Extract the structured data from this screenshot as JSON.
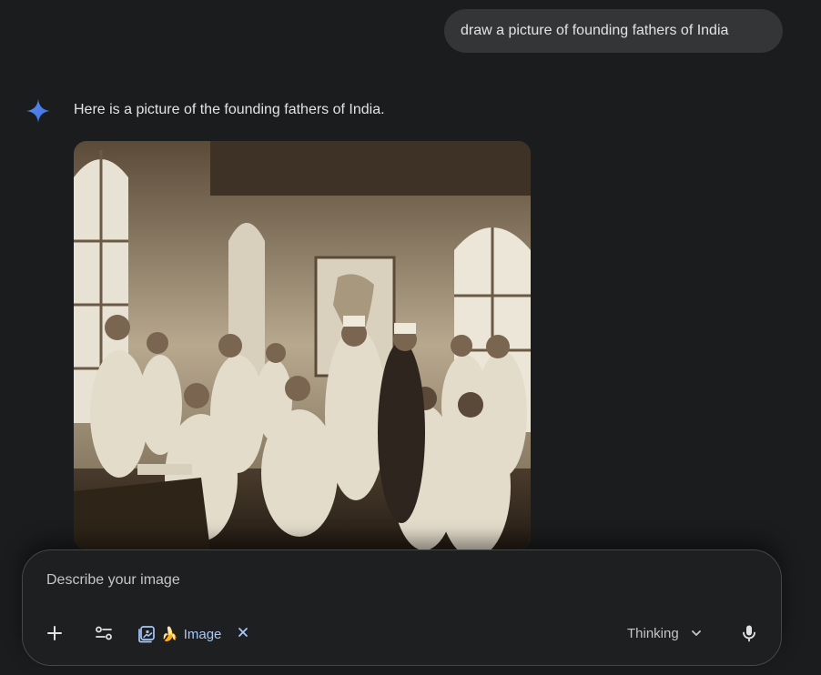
{
  "conversation": {
    "user_prompt": "draw a picture of founding fathers of India",
    "response_text": "Here is a picture of the founding fathers of India.",
    "generated_image": {
      "description_icon": "sepia-group-photo"
    }
  },
  "composer": {
    "placeholder": "Describe your image",
    "plus_icon": "plus-icon",
    "tools_icon": "tune-icon",
    "image_chip": {
      "icon": "image-gen-icon",
      "emoji": "🍌",
      "label": "Image"
    },
    "mode": {
      "label": "Thinking",
      "icon": "chevron-down-icon"
    },
    "mic_icon": "mic-icon"
  },
  "colors": {
    "background": "#1b1c1d",
    "bubble": "#333537",
    "accent": "#a8c7fa",
    "spark_blue": "#4285f4"
  }
}
